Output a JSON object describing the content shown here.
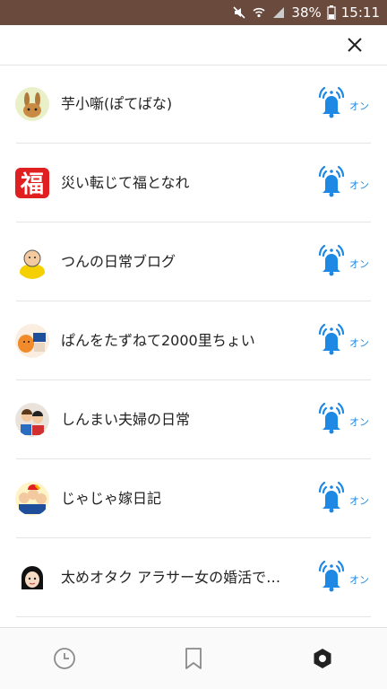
{
  "status_bar": {
    "battery": "38%",
    "time": "15:11",
    "icons": [
      "mute-icon",
      "wifi-icon",
      "signal-icon",
      "battery-icon"
    ]
  },
  "header": {
    "close_icon": "close-icon"
  },
  "subscriptions": [
    {
      "name": "芋小噺(ぽてばな)",
      "toggle": "オン",
      "avatar_icon": "rabbit-avatar"
    },
    {
      "name": "災い転じて福となれ",
      "toggle": "オン",
      "avatar_icon": "fuku-avatar"
    },
    {
      "name": "つんの日常ブログ",
      "toggle": "オン",
      "avatar_icon": "bald-man-avatar"
    },
    {
      "name": "ぱんをたずねて2000里ちょい",
      "toggle": "オン",
      "avatar_icon": "bread-avatar"
    },
    {
      "name": "しんまい夫婦の日常",
      "toggle": "オン",
      "avatar_icon": "couple-avatar"
    },
    {
      "name": "じゃじゃ嫁日記",
      "toggle": "オン",
      "avatar_icon": "family-avatar"
    },
    {
      "name": "太めオタク アラサー女の婚活で…",
      "toggle": "オン",
      "avatar_icon": "girl-avatar"
    }
  ],
  "bottom_nav": [
    "history-icon",
    "bookmark-icon",
    "settings-icon"
  ],
  "colors": {
    "status_bar": "#6b4a3e",
    "accent_blue": "#1e88e5"
  }
}
